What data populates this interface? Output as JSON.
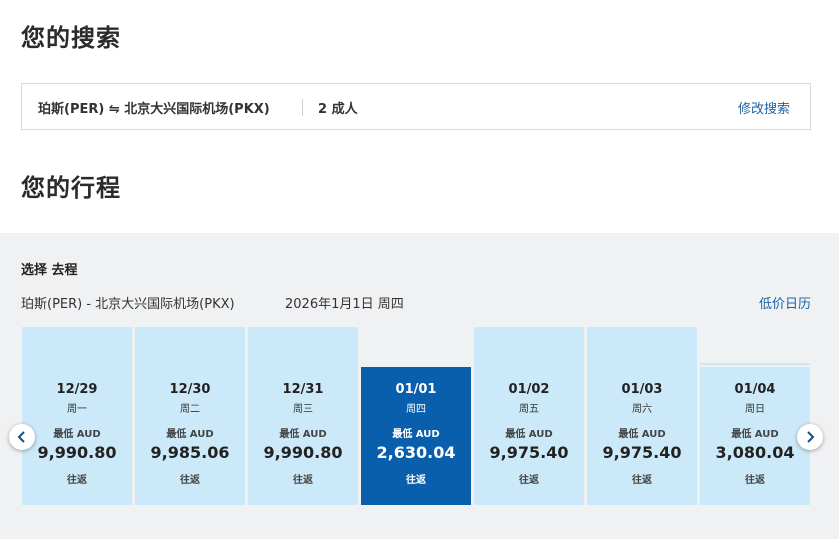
{
  "search": {
    "heading": "您的搜索",
    "route": "珀斯(PER) ⇋ 北京大兴国际机场(PKX)",
    "passengers": "2 成人",
    "modify_label": "修改搜索"
  },
  "itinerary": {
    "heading": "您的行程",
    "select_label": "选择 去程",
    "route": "珀斯(PER) - 北京大兴国际机场(PKX)",
    "date": "2026年1月1日 周四",
    "low_fare_calendar": "低价日历"
  },
  "calendar": {
    "days": [
      {
        "date": "12/29",
        "weekday": "周一",
        "label": "最低 AUD",
        "price": "9,990.80",
        "trip": "往返",
        "selected": false,
        "bar": 1
      },
      {
        "date": "12/30",
        "weekday": "周二",
        "label": "最低 AUD",
        "price": "9,985.06",
        "trip": "往返",
        "selected": false,
        "bar": 1
      },
      {
        "date": "12/31",
        "weekday": "周三",
        "label": "最低 AUD",
        "price": "9,990.80",
        "trip": "往返",
        "selected": false,
        "bar": 1
      },
      {
        "date": "01/01",
        "weekday": "周四",
        "label": "最低 AUD",
        "price": "2,630.04",
        "trip": "往返",
        "selected": true,
        "bar": 0
      },
      {
        "date": "01/02",
        "weekday": "周五",
        "label": "最低 AUD",
        "price": "9,975.40",
        "trip": "往返",
        "selected": false,
        "bar": 1
      },
      {
        "date": "01/03",
        "weekday": "周六",
        "label": "最低 AUD",
        "price": "9,975.40",
        "trip": "往返",
        "selected": false,
        "bar": 1
      },
      {
        "date": "01/04",
        "weekday": "周日",
        "label": "最低 AUD",
        "price": "3,080.04",
        "trip": "往返",
        "selected": false,
        "bar": 0.05
      }
    ]
  },
  "icons": {
    "prev": "chevron-left-icon",
    "next": "chevron-right-icon"
  },
  "colors": {
    "accent": "#0a5fad",
    "cell": "#cce9f9",
    "link": "#1a63a8"
  }
}
